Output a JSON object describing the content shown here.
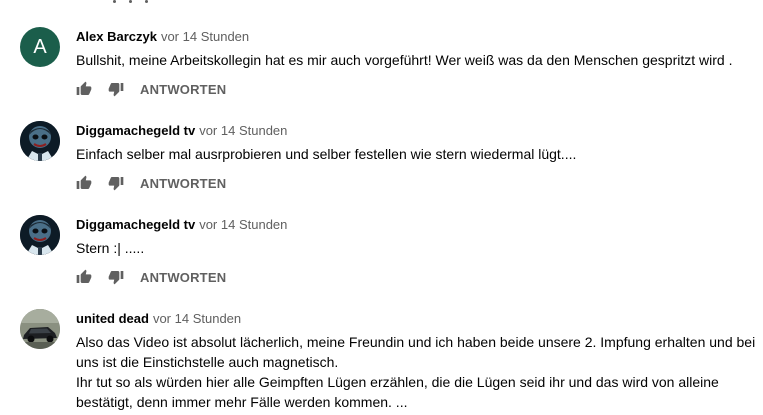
{
  "comments": [
    {
      "author": "Alex Barczyk",
      "time": "vor 14 Stunden",
      "avatar_letter": "A",
      "avatar_color": "#1b5e4b",
      "text": "Bullshit, meine Arbeitskollegin hat es mir auch vorgeführt!  Wer weiß was da den Menschen gespritzt wird .",
      "reply_label": "ANTWORTEN"
    },
    {
      "author": "Diggamachegeld tv",
      "time": "vor 14 Stunden",
      "avatar_icon": "joker-avatar-image",
      "text": "Einfach selber mal ausrprobieren und selber festellen wie stern wiedermal lügt....",
      "reply_label": "ANTWORTEN"
    },
    {
      "author": "Diggamachegeld tv",
      "time": "vor 14 Stunden",
      "avatar_icon": "joker-avatar-image",
      "text": "Stern :| .....",
      "reply_label": "ANTWORTEN"
    },
    {
      "author": "united dead",
      "time": "vor 14 Stunden",
      "avatar_icon": "car-avatar-image",
      "text": "Also das Video ist absolut lächerlich, meine Freundin und ich haben beide unsere 2. Impfung erhalten und bei uns ist die Einstichstelle auch magnetisch.\nIhr tut so als würden hier alle Geimpften Lügen erzählen, die die Lügen seid ihr und das wird von alleine bestätigt, denn immer mehr Fälle werden kommen. ..."
    }
  ],
  "icons": {
    "like": "thumb-up-icon",
    "dislike": "thumb-down-icon"
  }
}
